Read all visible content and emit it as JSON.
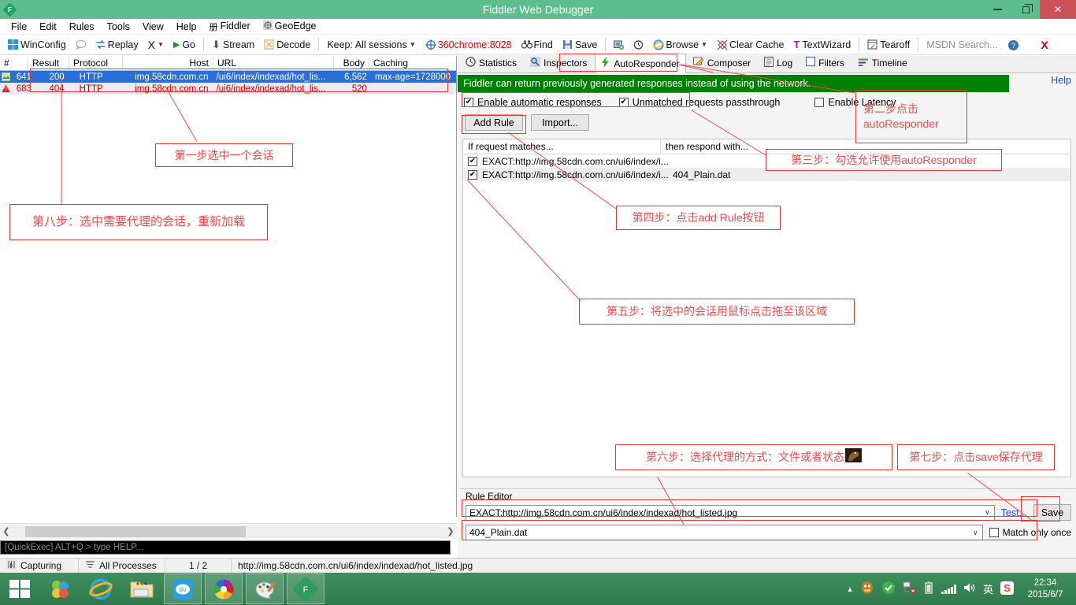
{
  "window": {
    "title": "Fiddler Web Debugger",
    "logo_letter": "F",
    "minimize": "minimize-button",
    "maximize": "maximize-button",
    "close": "×"
  },
  "menu": [
    {
      "label": "File"
    },
    {
      "label": "Edit"
    },
    {
      "label": "Rules"
    },
    {
      "label": "Tools"
    },
    {
      "label": "View"
    },
    {
      "label": "Help"
    },
    {
      "label": "Fiddler"
    },
    {
      "label": "GeoEdge"
    }
  ],
  "toolbar": {
    "winconfig": "WinConfig",
    "replay": "Replay",
    "remove": "X",
    "go": "Go",
    "stream": "Stream",
    "decode": "Decode",
    "keep": "Keep: All sessions",
    "process": "360chrome:8028",
    "find": "Find",
    "save": "Save",
    "browse": "Browse",
    "clear_cache": "Clear Cache",
    "textwizard": "TextWizard",
    "tearoff": "Tearoff",
    "msdn_placeholder": "MSDN Search...",
    "close_x": "X"
  },
  "sessions": {
    "columns": [
      "#",
      "Result",
      "Protocol",
      "Host",
      "URL",
      "Body",
      "Caching"
    ],
    "rows": [
      {
        "id": "641",
        "result": "200",
        "protocol": "HTTP",
        "host": "img.58cdn.com.cn",
        "url": "/ui6/index/indexad/hot_lis...",
        "body": "6,562",
        "caching": "max-age=1728000",
        "state": "selected"
      },
      {
        "id": "683",
        "result": "404",
        "protocol": "HTTP",
        "host": "img.58cdn.com.cn",
        "url": "/ui6/index/indexad/hot_lis...",
        "body": "520",
        "caching": "",
        "state": "error"
      }
    ]
  },
  "quickexec": "[QuickExec] ALT+Q > type HELP...",
  "statusbar": {
    "capturing": "Capturing",
    "processes": "All Processes",
    "count": "1 / 2",
    "url": "http://img.58cdn.com.cn/ui6/index/indexad/hot_listed.jpg"
  },
  "tabs": [
    {
      "label": "Statistics",
      "icon": "clock-icon",
      "active": false
    },
    {
      "label": "Inspectors",
      "icon": "inspectors-icon",
      "active": false
    },
    {
      "label": "AutoResponder",
      "icon": "lightning-icon",
      "active": true
    },
    {
      "label": "Composer",
      "icon": "pencil-icon",
      "active": false
    },
    {
      "label": "Log",
      "icon": "log-icon",
      "active": false
    },
    {
      "label": "Filters",
      "icon": "filter-icon",
      "active": false
    },
    {
      "label": "Timeline",
      "icon": "timeline-icon",
      "active": false
    }
  ],
  "autoresponder": {
    "banner": "Fiddler can return previously generated responses instead of using the network.",
    "help": "Help",
    "checkboxes": [
      {
        "label": "Enable automatic responses",
        "checked": true
      },
      {
        "label": "Unmatched requests passthrough",
        "checked": true
      },
      {
        "label": "Enable Latency",
        "checked": false
      }
    ],
    "add_rule": "Add Rule",
    "import": "Import...",
    "col_match": "If request matches...",
    "col_respond": "then respond with...",
    "rules": [
      {
        "match": "EXACT:http://img.58cdn.com.cn/ui6/index/i...",
        "respond": "",
        "checked": true
      },
      {
        "match": "EXACT:http://img.58cdn.com.cn/ui6/index/i...",
        "respond": "404_Plain.dat",
        "checked": true
      }
    ]
  },
  "rule_editor": {
    "title": "Rule Editor",
    "match_value": "EXACT:http://img.58cdn.com.cn/ui6/index/indexad/hot_listed.jpg",
    "response_value": "404_Plain.dat",
    "test": "Test...",
    "save": "Save",
    "match_once": "Match only once",
    "match_once_checked": false
  },
  "annotations": [
    {
      "id": "step1",
      "text": "第一步选中一个会话"
    },
    {
      "id": "step8",
      "text": "第八步：选中需要代理的会话，重新加载"
    },
    {
      "id": "step2_line1",
      "text": "第二步点击"
    },
    {
      "id": "step2_line2",
      "text": "autoResponder"
    },
    {
      "id": "step3",
      "text": "第三步：勾选允许使用autoResponder"
    },
    {
      "id": "step4",
      "text": "第四步：点击add Rule按钮"
    },
    {
      "id": "step5",
      "text": "第五步：将选中的会话用鼠标点击拖至该区域"
    },
    {
      "id": "step6",
      "text": "第六步：选择代理的方式：文件或者状态"
    },
    {
      "id": "step7",
      "text": "第七步：点击save保存代理"
    }
  ],
  "taskbar": {
    "start": "start-button",
    "items": [
      {
        "name": "windows-security-icon",
        "open": false
      },
      {
        "name": "internet-explorer-icon",
        "open": false
      },
      {
        "name": "file-explorer-icon",
        "open": false
      },
      {
        "name": "baidu-music-icon",
        "open": true
      },
      {
        "name": "360-chrome-icon",
        "open": true
      },
      {
        "name": "paint-icon",
        "open": true
      },
      {
        "name": "fiddler-icon",
        "open": true
      }
    ],
    "tray": [
      "qq-icon",
      "360-shield-icon",
      "network-icon",
      "battery-icon",
      "signal-icon",
      "volume-icon",
      "ime-icon",
      "sogou-icon"
    ],
    "ime": "英",
    "time": "22:34",
    "date": "2015/6/7"
  },
  "colors": {
    "title_bar": "#5cbd8d",
    "banner_green": "#008000",
    "selection_blue": "#2b6ed6",
    "annotation_red": "#ef4b4b",
    "taskbar_green": "#35814f"
  }
}
